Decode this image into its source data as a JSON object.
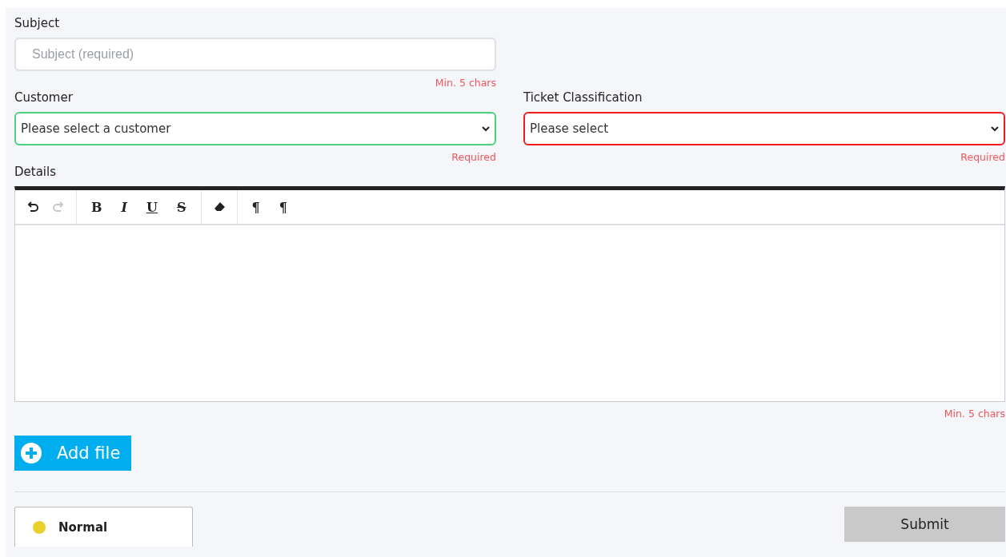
{
  "subject": {
    "label": "Subject",
    "placeholder": "Subject (required)",
    "hint": "Min. 5 chars"
  },
  "customer": {
    "label": "Customer",
    "value": "Please select a customer",
    "invalid": false,
    "hint": "Required"
  },
  "classification": {
    "label": "Ticket Classification",
    "value": "Please select",
    "invalid": true,
    "hint": "Required"
  },
  "details": {
    "label": "Details",
    "hint": "Min. 5 chars",
    "toolbar": [
      [
        {
          "kind": "undo",
          "disabled": false
        },
        {
          "kind": "redo",
          "disabled": true
        }
      ],
      [
        {
          "kind": "bold",
          "label": "B",
          "disabled": false
        },
        {
          "kind": "italic",
          "label": "I",
          "disabled": false
        },
        {
          "kind": "underline",
          "label": "U",
          "disabled": false
        },
        {
          "kind": "strike",
          "label": "S",
          "disabled": false
        }
      ],
      [
        {
          "kind": "eraser",
          "disabled": false
        }
      ],
      [
        {
          "kind": "ltr",
          "label": "¶",
          "disabled": false
        },
        {
          "kind": "rtl",
          "label": "¶",
          "disabled": false
        }
      ]
    ]
  },
  "add_file": {
    "label": "Add file"
  },
  "priority": {
    "label": "Normal",
    "color": "#e8d12a"
  },
  "submit": {
    "label": "Submit"
  }
}
